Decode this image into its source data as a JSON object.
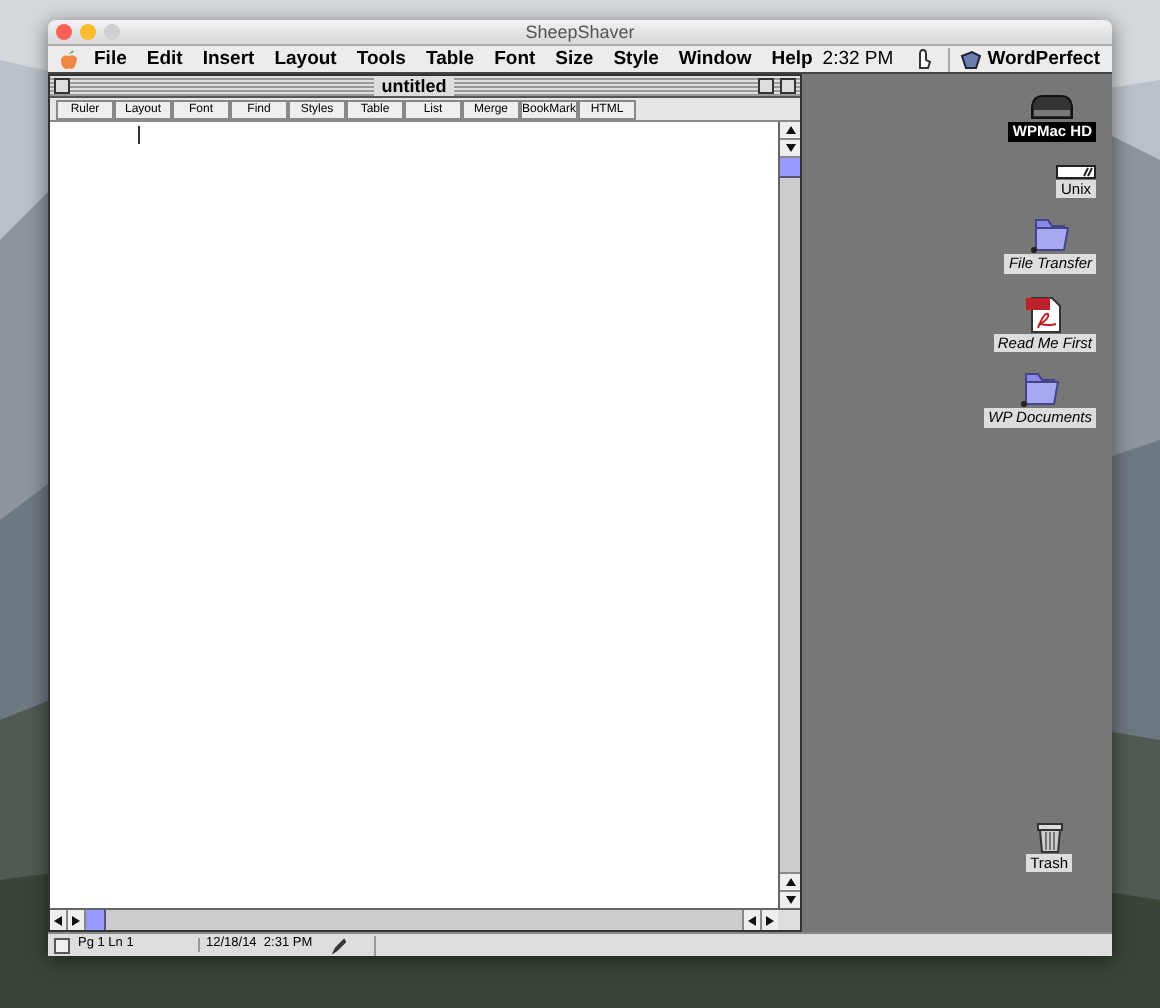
{
  "window": {
    "title": "SheepShaver"
  },
  "menu_bar": {
    "items": [
      "File",
      "Edit",
      "Insert",
      "Layout",
      "Tools",
      "Table",
      "Font",
      "Size",
      "Style",
      "Window",
      "Help"
    ],
    "clock": "2:32 PM",
    "app": "WordPerfect"
  },
  "document": {
    "title": "untitled",
    "toolbar": [
      "Ruler",
      "Layout",
      "Font",
      "Find",
      "Styles",
      "Table",
      "List",
      "Merge",
      "BookMark",
      "HTML"
    ]
  },
  "status_bar": {
    "position": "Pg 1 Ln 1",
    "datetime": "12/18/14  2:31 PM"
  },
  "desktop_icons": [
    {
      "label": "WPMac HD",
      "kind": "disk",
      "selected": true
    },
    {
      "label": "Unix",
      "kind": "drive",
      "selected": false
    },
    {
      "label": "File Transfer",
      "kind": "folder",
      "selected": false
    },
    {
      "label": "Read Me First",
      "kind": "pdf",
      "selected": false
    },
    {
      "label": "WP Documents",
      "kind": "folder",
      "selected": false
    },
    {
      "label": "Trash",
      "kind": "trash",
      "selected": false
    }
  ]
}
